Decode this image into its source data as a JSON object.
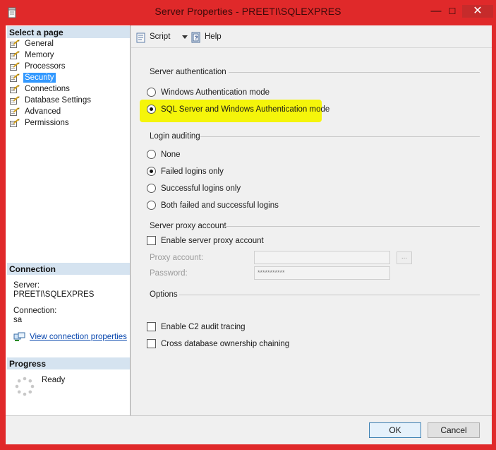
{
  "window": {
    "title": "Server Properties - PREETI\\SQLEXPRES",
    "minimize_label": "—",
    "maximize_label": "☐",
    "close_label": "✕"
  },
  "sidebar": {
    "select_page_header": "Select a page",
    "pages": [
      {
        "label": "General",
        "selected": false
      },
      {
        "label": "Memory",
        "selected": false
      },
      {
        "label": "Processors",
        "selected": false
      },
      {
        "label": "Security",
        "selected": true
      },
      {
        "label": "Connections",
        "selected": false
      },
      {
        "label": "Database Settings",
        "selected": false
      },
      {
        "label": "Advanced",
        "selected": false
      },
      {
        "label": "Permissions",
        "selected": false
      }
    ],
    "page_icon": "properties-page-icon",
    "connection_header": "Connection",
    "server_label": "Server:",
    "server_value": "PREETI\\SQLEXPRES",
    "connection_label": "Connection:",
    "connection_value": "sa",
    "view_connection_link": "View connection properties",
    "progress_header": "Progress",
    "progress_status": "Ready"
  },
  "toolbar": {
    "script_label": "Script",
    "help_label": "Help",
    "script_icon": "script-icon",
    "help_icon": "help-icon"
  },
  "server_authentication": {
    "title": "Server authentication",
    "options": [
      {
        "label": "Windows Authentication mode",
        "checked": false
      },
      {
        "label": "SQL Server and Windows Authentication mode",
        "checked": true
      }
    ]
  },
  "login_auditing": {
    "title": "Login auditing",
    "options": [
      {
        "label": "None",
        "checked": false
      },
      {
        "label": "Failed logins only",
        "checked": true
      },
      {
        "label": "Successful logins only",
        "checked": false
      },
      {
        "label": "Both failed and successful logins",
        "checked": false
      }
    ]
  },
  "server_proxy_account": {
    "title": "Server proxy account",
    "enable_label": "Enable server proxy account",
    "enable_checked": false,
    "proxy_account_label": "Proxy account:",
    "proxy_account_value": "",
    "browse_label": "...",
    "password_label": "Password:",
    "password_value": "***********"
  },
  "options": {
    "title": "Options",
    "c2_audit_label": "Enable C2 audit tracing",
    "c2_audit_checked": false,
    "cross_db_label": "Cross database ownership chaining",
    "cross_db_checked": false
  },
  "buttons": {
    "ok_label": "OK",
    "cancel_label": "Cancel"
  },
  "colors": {
    "window_frame": "#e0292a",
    "selection": "#3399ff",
    "highlight": "#f5f50a",
    "section_header": "#d5e3f0"
  }
}
